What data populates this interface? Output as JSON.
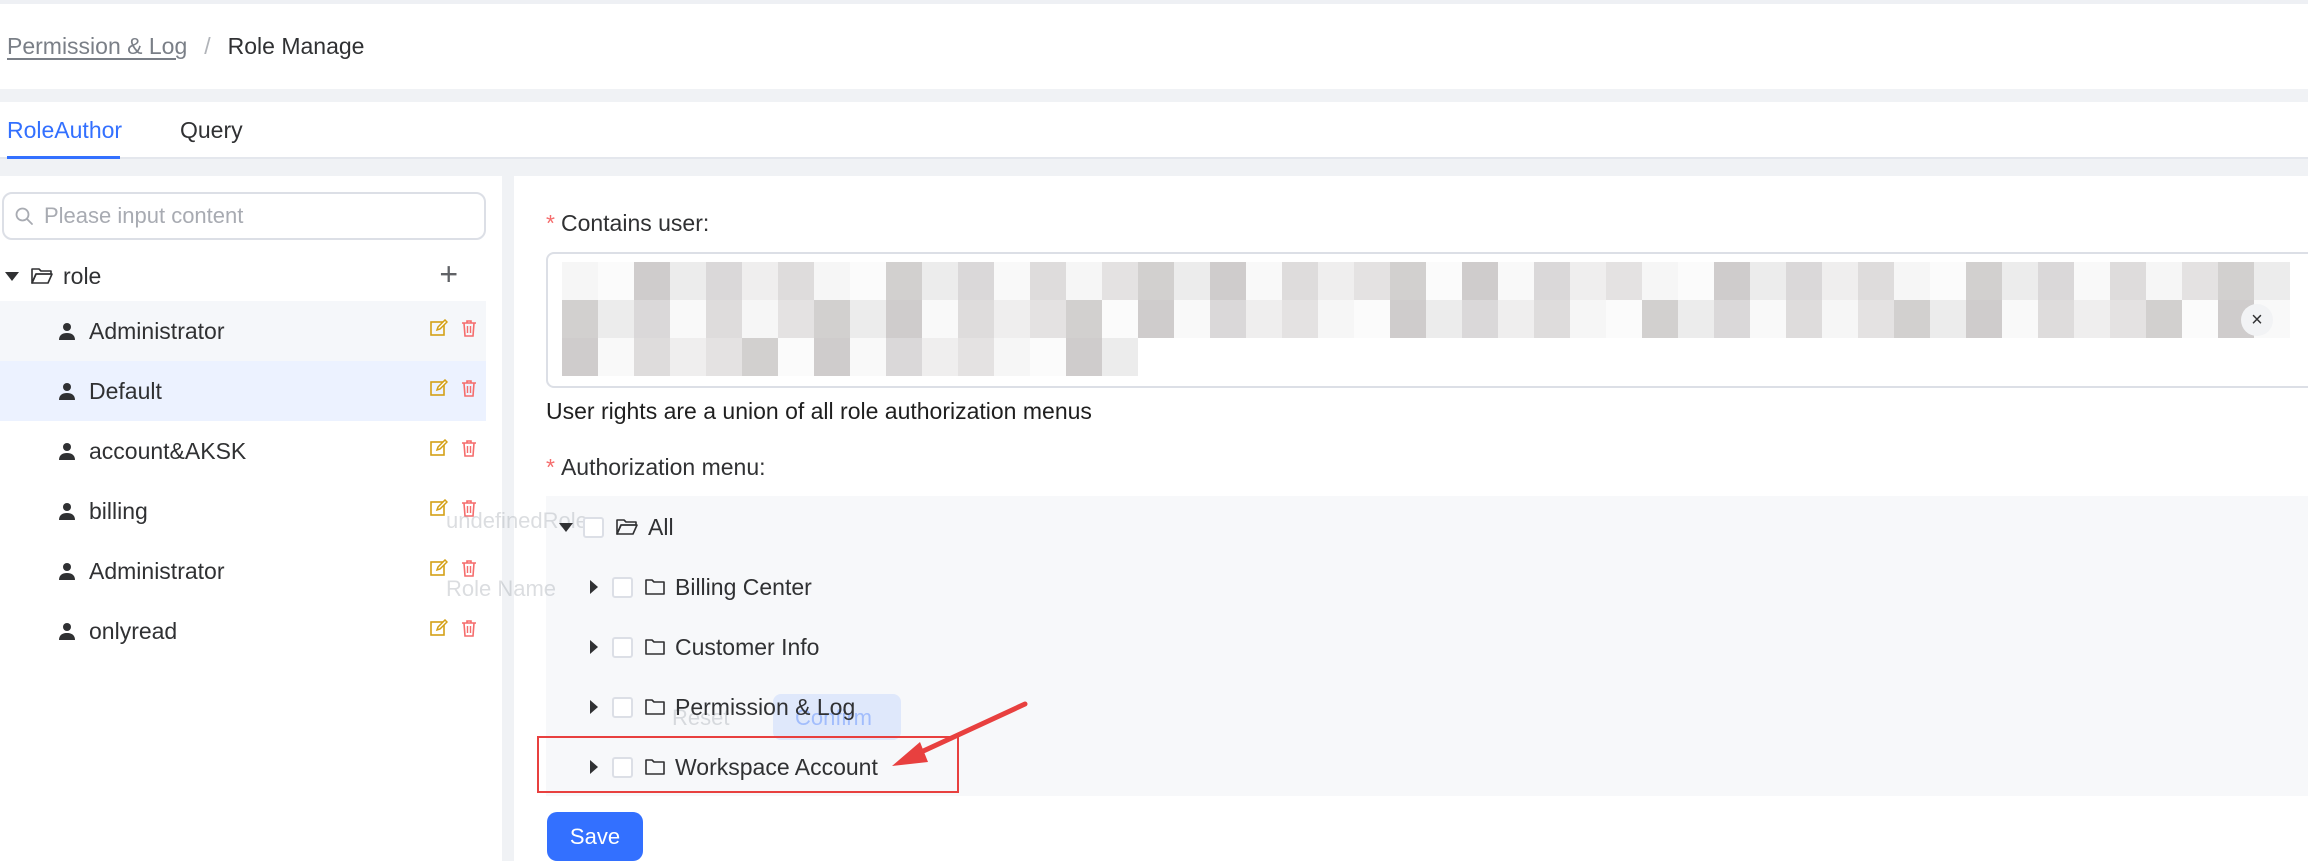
{
  "breadcrumb": {
    "parent": "Permission & Log",
    "separator": "/",
    "current": "Role Manage"
  },
  "tabs": [
    {
      "label": "RoleAuthor",
      "active": true
    },
    {
      "label": "Query",
      "active": false
    }
  ],
  "sidebar": {
    "search_placeholder": "Please input content",
    "root_label": "role",
    "roles": [
      {
        "label": "Administrator"
      },
      {
        "label": "Default"
      },
      {
        "label": "account&AKSK"
      },
      {
        "label": "billing"
      },
      {
        "label": "Administrator"
      },
      {
        "label": "onlyread"
      }
    ]
  },
  "form": {
    "contains_user_label": "Contains user:",
    "required_mark": "*",
    "clear_symbol": "×",
    "hint": "User rights are a union of all role authorization menus",
    "auth_menu_label": "Authorization menu:",
    "menu_root": "All",
    "menu_items": [
      "Billing Center",
      "Customer Info",
      "Permission & Log",
      "Workspace Account"
    ],
    "save_label": "Save"
  },
  "overlay_ghost": {
    "title": "undefinedRole",
    "role_name": "Role Name",
    "reset": "Reset",
    "confirm": "Confirm"
  },
  "colors": {
    "primary": "#3370ff",
    "danger": "#f56c6c",
    "annotation": "#e8403f",
    "selected_row": "#ecf2ff"
  }
}
